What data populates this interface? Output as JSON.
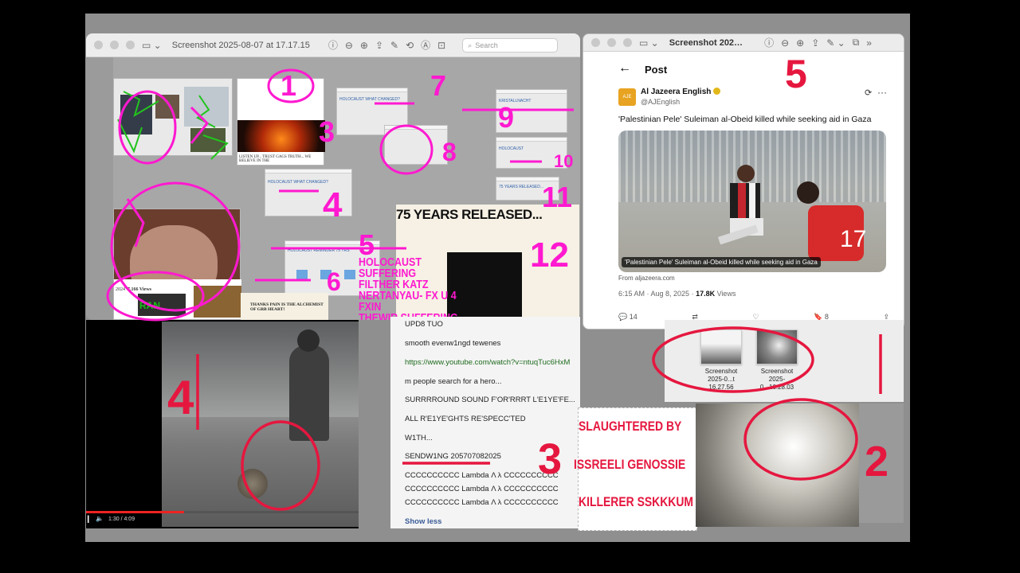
{
  "left_window": {
    "title": "Screenshot 2025-08-07 at 17.17.15",
    "search_placeholder": "Search"
  },
  "collage": {
    "headline": "75 YEARS RELEASED...",
    "holo_line1": "HOLOCAUST SUFFERING",
    "holo_line2": "FILTHER KATZ",
    "holo_line3": "NERTANYAU- FX U 4 FXIN",
    "holo_line4": "THEWIR SUFFERING",
    "listen_line": "LISTEN UP... TRUST GAGS TRUTH... WE BELIEVE IN THE",
    "thanks_line": "THANKS PAIN IS THE ALCHEMIST OF GRB HEART!",
    "views": "7,166 Views",
    "year": "2024",
    "mini_labels": [
      "HOLOCAUST WHAT CHANGED?",
      "HOLOCAUST WHAT CHANGED?",
      "HOLOCAUST REMINDER 75 YRS",
      "75 YEARS RELEASED...",
      "HOLOCAUST",
      "KRISTALLNACHT"
    ],
    "red_text": "RAN"
  },
  "right_window": {
    "title": "Screenshot 202…",
    "post_label": "Post",
    "account_name": "Al Jazeera English",
    "account_handle": "@AJEnglish",
    "tweet_text": "'Palestinian Pele' Suleiman al-Obeid killed while seeking aid in Gaza",
    "media_caption": "'Palestinian Pele' Suleiman al-Obeid killed while seeking aid in Gaza",
    "source": "From aljazeera.com",
    "time": "6:15 AM · Aug 8, 2025 · ",
    "views_count": "17.8K",
    "views_label": " Views",
    "replies": "14",
    "bookmarks": "8"
  },
  "video": {
    "time": "1:30 / 4:09",
    "progress": 0.36
  },
  "panel": {
    "lines": [
      "UPD8 TUO",
      "smooth evenw1ngd tewenes",
      "https://www.youtube.com/watch?v=ntuqTuc6HxM",
      "m people search for a hero...",
      "SURRRROUND SOUND F'OR'RRRT L'E1YE'FE...",
      "ALL R'E1YE'GHTS RE'SPECC'TED",
      "W1TH...",
      "SENDW1NG 2057070820​25",
      "CCCCCCCCCC Lambda Λ λ CCCCCCCCCC",
      "CCCCCCCCCC Lambda Λ λ CCCCCCCCCC",
      "CCCCCCCCCC Lambda Λ λ CCCCCCCCCC"
    ],
    "show_less": "Show less"
  },
  "slaughter": {
    "line1": "SLAUGHTERED BY",
    "line2": "ISSREELI GENOSSIE",
    "line3": "KILLERER SSKKKUM"
  },
  "finder": {
    "file1_name": "Screenshot",
    "file1_date": "2025-0...t 16.27.56",
    "file2_name": "Screenshot",
    "file2_date": "2025-0...16.28.03"
  },
  "annotations": {
    "n1": "1",
    "n2": "2",
    "n3": "3",
    "n4": "4",
    "n5": "5",
    "n6": "6",
    "n7": "7",
    "n8": "8",
    "n9": "9",
    "n10": "10",
    "n11": "11",
    "n12": "12",
    "r1": "1",
    "r2": "2",
    "r3": "3",
    "r4": "4",
    "r5": "5"
  },
  "colors": {
    "magenta": "#ff19d0",
    "red": "#e5173f",
    "green": "#22c41d"
  }
}
